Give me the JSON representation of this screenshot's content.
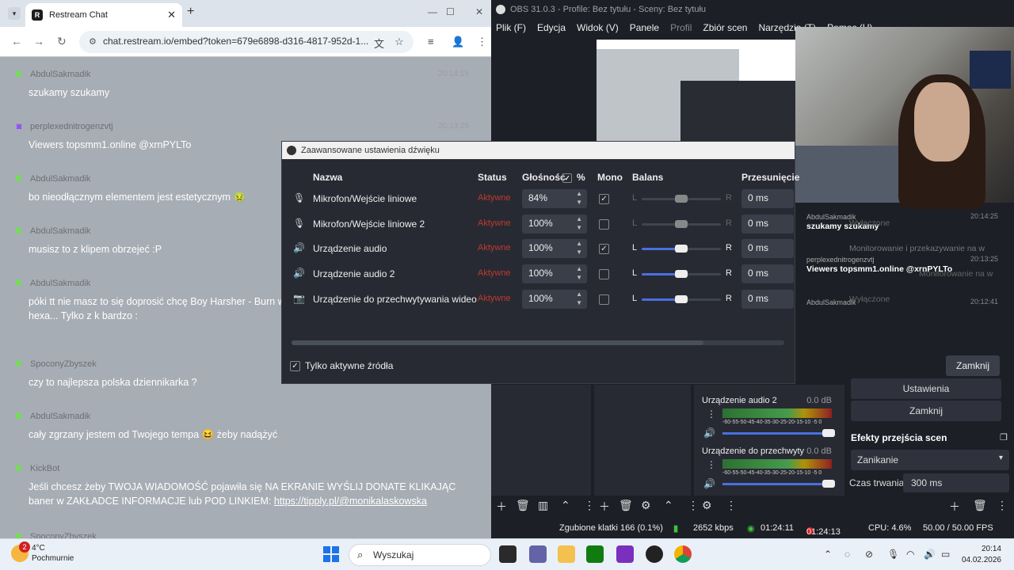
{
  "chrome": {
    "tab_title": "Restream Chat",
    "url": "chat.restream.io/embed?token=679e6898-d316-4817-952d-1...",
    "messages": [
      {
        "platform": "kick",
        "author": "AbdulSakmadik",
        "time": "20:14:15",
        "text": "szukamy szukamy"
      },
      {
        "platform": "twitch",
        "author": "perplexednitrogenzvtj",
        "time": "20:13:25",
        "text": "Viewers topsmm1.online @xrnPYLTo"
      },
      {
        "platform": "kick",
        "author": "AbdulSakmadik",
        "time": "",
        "text": "bo nieodłącznym elementem jest estetycznym 🤢"
      },
      {
        "platform": "kick",
        "author": "AbdulSakmadik",
        "time": "",
        "text": "musisz to z klipem obrzejeć :P"
      },
      {
        "platform": "kick",
        "author": "AbdulSakmadik",
        "time": "",
        "text": "póki tt nie masz to się doprosić chcę Boy Harsher - Burn wkręciło, że „ostatni raz” słucham jak Ty hexa... Tylko z k bardzo :"
      },
      {
        "platform": "kick",
        "author": "SpoconyZbyszek",
        "time": "",
        "text": "czy to najlepsza polska dziennikarka ?"
      },
      {
        "platform": "kick",
        "author": "AbdulSakmadik",
        "time": "",
        "text": "cały zgrzany jestem od Twojego tempa 😆 żeby nadążyć"
      },
      {
        "platform": "kick",
        "author": "KickBot",
        "time": "",
        "text": "Jeśli chcesz żeby TWOJA WIADOMOŚĆ pojawiła się NA EKRANIE WYŚLIJ DONATE KLIKAJĄC baner w ZAKŁADCE INFORMACJE lub POD LINKIEM: ",
        "link": "https://tipply.pl/@monikalaskowska"
      },
      {
        "platform": "kick",
        "author": "SpoconyZbyszek",
        "time": "",
        "text": ""
      }
    ]
  },
  "obs": {
    "title": "OBS 31.0.3 - Profile: Bez tytułu - Sceny: Bez tytułu",
    "menu": [
      "Plik (F)",
      "Edycja",
      "Widok (V)",
      "Panele",
      "Profil",
      "Zbiór scen",
      "Narzędzia (T)",
      "Pomoc (H)"
    ],
    "overlay": {
      "m1_author": "AbdulSakmadik",
      "m1_time": "20:14:25",
      "m1_text": "szukamy szukamy",
      "m2_author": "perplexednitrogenzvtj",
      "m2_time": "20:13:25",
      "m2_text": "Viewers topsmm1.online @xrnPYLTo",
      "m3_author": "AbdulSakmadik",
      "m3_time": "20:12:41",
      "ghost1": "Wyłączone",
      "ghost2": "Monitorowanie i przekazywanie na w",
      "ghost3": "Monitorowanie na w",
      "ghost4": "Wyłączone"
    },
    "mixer": [
      {
        "name": "Urządzenie audio 2",
        "db": "0.0 dB"
      },
      {
        "name": "Urządzenie do przechwyty",
        "db": "0.0 dB"
      }
    ],
    "ticks": "-60-55-50-45-40-35-30-25-20-15-10 -5 0",
    "controls": {
      "settings": "Ustawienia",
      "close": "Zamknij"
    },
    "transitions": {
      "title": "Efekty przejścia scen",
      "selected": "Zanikanie",
      "duration_label": "Czas trwania",
      "duration": "300 ms"
    },
    "status": {
      "dropped": "Zgubione klatki 166 (0.1%)",
      "kbps": "2652 kbps",
      "stream_time": "01:24:11",
      "rec_time": "01:24:13",
      "cpu": "CPU: 4.6%",
      "fps": "50.00 / 50.00 FPS"
    }
  },
  "dialog": {
    "title": "Zaawansowane ustawienia dźwięku",
    "headers": {
      "name": "Nazwa",
      "status": "Status",
      "volume": "Głośność",
      "percent": "%",
      "mono": "Mono",
      "balance": "Balans",
      "offset": "Przesunięcie"
    },
    "rows": [
      {
        "icon": "microphone-icon",
        "name": "Mikrofon/Wejście liniowe",
        "status": "Aktywne",
        "volume": "84%",
        "mono": true,
        "balance": 0.5,
        "offset": "0 ms"
      },
      {
        "icon": "microphone-icon",
        "name": "Mikrofon/Wejście liniowe 2",
        "status": "Aktywne",
        "volume": "100%",
        "mono": false,
        "balance": 0.5,
        "offset": "0 ms"
      },
      {
        "icon": "speaker-icon",
        "name": "Urządzenie audio",
        "status": "Aktywne",
        "volume": "100%",
        "mono": true,
        "balance": 0.5,
        "offset": "0 ms"
      },
      {
        "icon": "speaker-icon",
        "name": "Urządzenie audio 2",
        "status": "Aktywne",
        "volume": "100%",
        "mono": false,
        "balance": 0.5,
        "offset": "0 ms"
      },
      {
        "icon": "camera-icon",
        "name": "Urządzenie do przechwytywania wideo",
        "status": "Aktywne",
        "volume": "100%",
        "mono": false,
        "balance": 0.5,
        "offset": "0 ms"
      }
    ],
    "balance_L": "L",
    "balance_R": "R",
    "only_active": "Tylko aktywne źródła",
    "close": "Zamknij"
  },
  "taskbar": {
    "temp": "4°C",
    "weather": "Pochmurnie",
    "badge": "2",
    "search": "Wyszukaj",
    "time": "20:14",
    "date": "04.02.2026"
  }
}
